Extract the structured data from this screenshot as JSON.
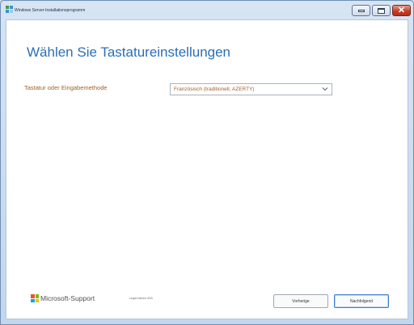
{
  "window": {
    "title": "Windows Server-Installationsprogramm",
    "controls": {
      "minimize_icon": "minimize-icon",
      "maximize_icon": "maximize-icon",
      "close_icon": "close-icon"
    }
  },
  "main": {
    "heading": "Wählen Sie Tastatureinstellungen",
    "keyboard_label": "Tastatur oder Eingabemethode",
    "keyboard_selected": "Französisch (traditionell, AZERTY)",
    "dropdown_icon": "chevron-down-icon"
  },
  "footer": {
    "brand": "Microsoft-Support",
    "legal": "Legal notices  USA",
    "back_label": "Vorherige",
    "next_label": "Nachfolgend"
  },
  "colors": {
    "heading": "#2a6fb7",
    "label": "#a3612a",
    "accent_button_border": "#3b7fcf",
    "close_button": "#c23b23"
  }
}
